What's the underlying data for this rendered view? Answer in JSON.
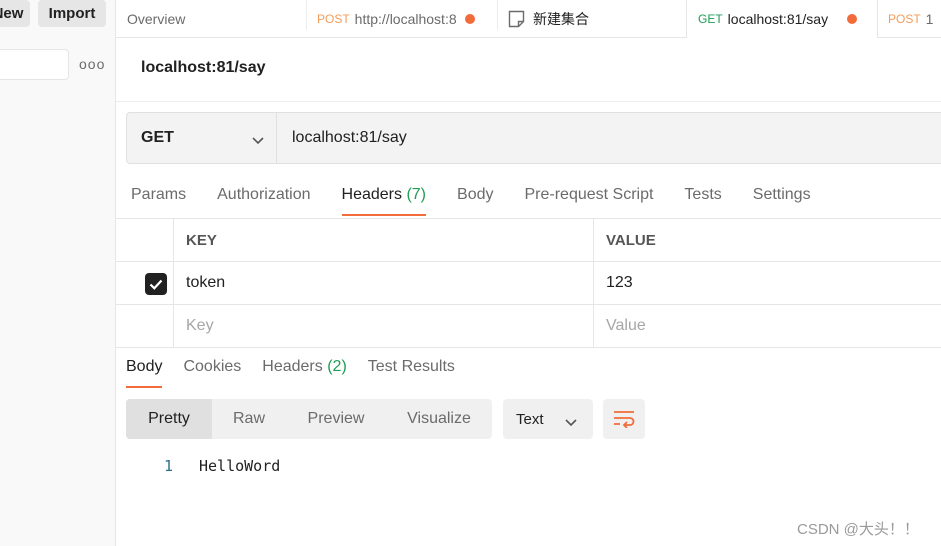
{
  "sidebar": {
    "new_label": "New",
    "import_label": "Import",
    "more_label": "ooo"
  },
  "tabs": [
    {
      "label": "Overview"
    },
    {
      "method": "POST",
      "label": "http://localhost:8"
    },
    {
      "label": "新建集合"
    },
    {
      "method": "GET",
      "label": "localhost:81/say"
    },
    {
      "method": "POST",
      "label": "1"
    }
  ],
  "request": {
    "title": "localhost:81/say",
    "method": "GET",
    "url": "localhost:81/say"
  },
  "request_tabs": {
    "params": "Params",
    "authorization": "Authorization",
    "headers": "Headers",
    "headers_count": "(7)",
    "body": "Body",
    "prerequest": "Pre-request Script",
    "tests": "Tests",
    "settings": "Settings"
  },
  "headers_table": {
    "key_header": "KEY",
    "value_header": "VALUE",
    "row": {
      "key": "token",
      "value": "123"
    },
    "placeholder_key": "Key",
    "placeholder_value": "Value"
  },
  "response_tabs": {
    "body": "Body",
    "cookies": "Cookies",
    "headers": "Headers",
    "headers_count": "(2)",
    "test_results": "Test Results"
  },
  "view_modes": {
    "pretty": "Pretty",
    "raw": "Raw",
    "preview": "Preview",
    "visualize": "Visualize"
  },
  "format_select": "Text",
  "response_body": {
    "line_number": "1",
    "line_text": "HelloWord"
  },
  "watermark": "CSDN @大头！！",
  "colors": {
    "accent": "#f26b3a",
    "get": "#1f9d55",
    "post": "#f39c5a"
  }
}
